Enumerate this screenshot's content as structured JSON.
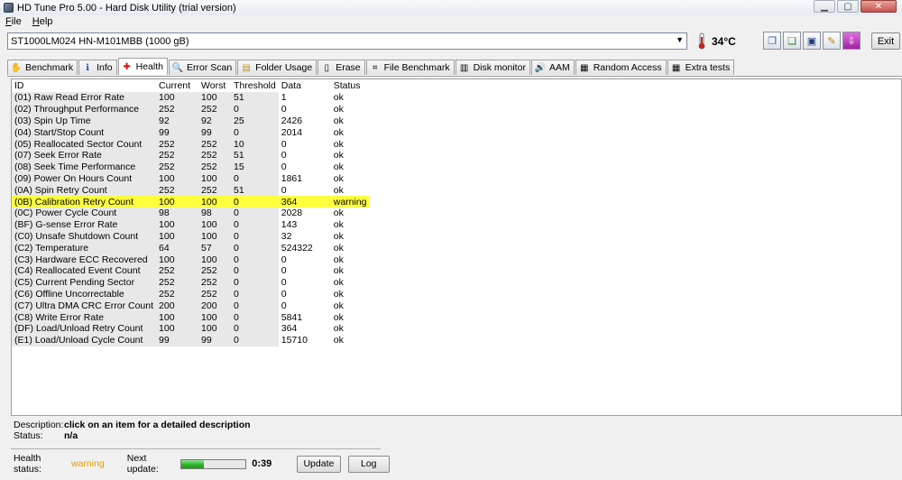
{
  "window": {
    "title": "HD Tune Pro 5.00 - Hard Disk Utility (trial version)"
  },
  "menu": [
    {
      "label": "File",
      "accel": "F",
      "rest": "ile"
    },
    {
      "label": "Help",
      "accel": "H",
      "rest": "elp"
    }
  ],
  "toolbar": {
    "drive": "ST1000LM024 HN-M101MBB (1000 gB)",
    "temperature": "34°C",
    "exit_label": "Exit"
  },
  "tabs": [
    {
      "label": "Benchmark",
      "icon": "benchmark-icon",
      "glyph": "✋"
    },
    {
      "label": "Info",
      "icon": "info-icon",
      "glyph": "ℹ"
    },
    {
      "label": "Health",
      "icon": "health-icon",
      "glyph": "✚"
    },
    {
      "label": "Error Scan",
      "icon": "magnifier-icon",
      "glyph": "🔍"
    },
    {
      "label": "Folder Usage",
      "icon": "folder-icon",
      "glyph": "▤"
    },
    {
      "label": "Erase",
      "icon": "erase-icon",
      "glyph": "▯"
    },
    {
      "label": "File Benchmark",
      "icon": "file-benchmark-icon",
      "glyph": "⌗"
    },
    {
      "label": "Disk monitor",
      "icon": "disk-monitor-icon",
      "glyph": "▥"
    },
    {
      "label": "AAM",
      "icon": "speaker-icon",
      "glyph": "🔊"
    },
    {
      "label": "Random Access",
      "icon": "random-access-icon",
      "glyph": "▦"
    },
    {
      "label": "Extra tests",
      "icon": "extra-tests-icon",
      "glyph": "▦"
    }
  ],
  "active_tab": "Health",
  "table": {
    "columns": [
      "ID",
      "Current",
      "Worst",
      "Threshold",
      "Data",
      "Status"
    ],
    "rows": [
      [
        "(01) Raw Read Error Rate",
        "100",
        "100",
        "51",
        "1",
        "ok"
      ],
      [
        "(02) Throughput Performance",
        "252",
        "252",
        "0",
        "0",
        "ok"
      ],
      [
        "(03) Spin Up Time",
        "92",
        "92",
        "25",
        "2426",
        "ok"
      ],
      [
        "(04) Start/Stop Count",
        "99",
        "99",
        "0",
        "2014",
        "ok"
      ],
      [
        "(05) Reallocated Sector Count",
        "252",
        "252",
        "10",
        "0",
        "ok"
      ],
      [
        "(07) Seek Error Rate",
        "252",
        "252",
        "51",
        "0",
        "ok"
      ],
      [
        "(08) Seek Time Performance",
        "252",
        "252",
        "15",
        "0",
        "ok"
      ],
      [
        "(09) Power On Hours Count",
        "100",
        "100",
        "0",
        "1861",
        "ok"
      ],
      [
        "(0A) Spin Retry Count",
        "252",
        "252",
        "51",
        "0",
        "ok"
      ],
      [
        "(0B) Calibration Retry Count",
        "100",
        "100",
        "0",
        "364",
        "warning"
      ],
      [
        "(0C) Power Cycle Count",
        "98",
        "98",
        "0",
        "2028",
        "ok"
      ],
      [
        "(BF) G-sense Error Rate",
        "100",
        "100",
        "0",
        "143",
        "ok"
      ],
      [
        "(C0) Unsafe Shutdown Count",
        "100",
        "100",
        "0",
        "32",
        "ok"
      ],
      [
        "(C2) Temperature",
        "64",
        "57",
        "0",
        "524322",
        "ok"
      ],
      [
        "(C3) Hardware ECC Recovered",
        "100",
        "100",
        "0",
        "0",
        "ok"
      ],
      [
        "(C4) Reallocated Event Count",
        "252",
        "252",
        "0",
        "0",
        "ok"
      ],
      [
        "(C5) Current Pending Sector",
        "252",
        "252",
        "0",
        "0",
        "ok"
      ],
      [
        "(C6) Offline Uncorrectable",
        "252",
        "252",
        "0",
        "0",
        "ok"
      ],
      [
        "(C7) Ultra DMA CRC Error Count",
        "200",
        "200",
        "0",
        "0",
        "ok"
      ],
      [
        "(C8) Write Error Rate",
        "100",
        "100",
        "0",
        "5841",
        "ok"
      ],
      [
        "(DF) Load/Unload Retry Count",
        "100",
        "100",
        "0",
        "364",
        "ok"
      ],
      [
        "(E1) Load/Unload Cycle Count",
        "99",
        "99",
        "0",
        "15710",
        "ok"
      ]
    ],
    "warning_color": "#ffff40"
  },
  "details": {
    "description_label": "Description:",
    "description_value": "click on an item for a detailed description",
    "status_label": "Status:",
    "status_value": "n/a"
  },
  "health": {
    "status_label": "Health status:",
    "status_value": "warning",
    "status_color": "#e0a000",
    "next_update_label": "Next update:",
    "progress": 0.35,
    "timer": "0:39",
    "update_label": "Update",
    "log_label": "Log"
  }
}
